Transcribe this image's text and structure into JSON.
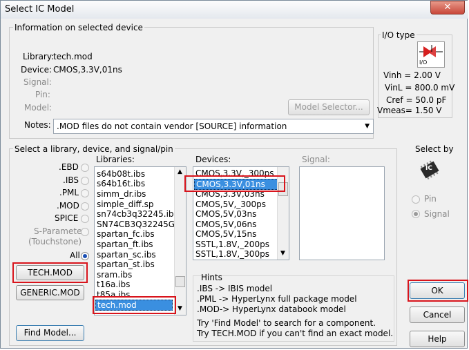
{
  "window": {
    "title": "Select IC Model",
    "close_glyph": "✕"
  },
  "info": {
    "group_label": "Information on selected device",
    "library_label": "Library:",
    "library_value": "tech.mod",
    "device_label": "Device:",
    "device_value": "CMOS,3.3V,01ns",
    "signal_label": "Signal:",
    "pin_label": "Pin:",
    "model_label": "Model:",
    "model_selector_button": "Model Selector...",
    "notes_label": "Notes:",
    "notes_value": ".MOD files do not contain vendor [SOURCE] information"
  },
  "io_type": {
    "group_label": "I/O type",
    "icon_caption": "I/O",
    "vinh": "Vinh = 2.00 V",
    "vinl": "VinL = 800.0 mV",
    "cref": "Cref = 50.0 pF",
    "vmeas": "Vmeas= 1.50 V"
  },
  "select": {
    "group_label": "Select a library, device, and signal/pin",
    "filters": [
      ".EBD",
      ".IBS",
      ".PML",
      ".MOD",
      "SPICE"
    ],
    "sparam_line1": "S-Parameter",
    "sparam_line2": "(Touchstone)",
    "all_label": "All",
    "tech_mod_button": "TECH.MOD",
    "generic_mod_button": "GENERIC.MOD",
    "libraries_label": "Libraries:",
    "libraries": [
      "s64b08t.ibs",
      "s64b16t.ibs",
      "simm_dr.ibs",
      "simple_diff.sp",
      "sn74cb3q32245.ibs",
      "SN74CB3Q32245GK",
      "spartan_fc.ibs",
      "spartan_ft.ibs",
      "spartan_sc.ibs",
      "spartan_st.ibs",
      "sram.ibs",
      "t16a.ibs",
      "t85a.ibs"
    ],
    "selected_library": "tech.mod",
    "devices_label": "Devices:",
    "devices": [
      "CMOS,3.3V,_300ps",
      "CMOS,3.3V,01ns",
      "CMOS,3.3V,03ns",
      "CMOS,5V,_300ps",
      "CMOS,5V,03ns",
      "CMOS,5V,06ns",
      "CMOS,5V,15ns",
      "SSTL,1.8V,_200ps",
      "SSTL,1.8V,_300ps"
    ],
    "signal_label": "Signal:",
    "hints": {
      "title": "Hints",
      "lines": [
        ".IBS   -> IBIS model",
        ".PML -> HyperLynx full package model",
        ".MOD-> HyperLynx databook model",
        "",
        "Try 'Find Model' to search for a component.",
        "Try TECH.MOD if you can't find an exact model."
      ]
    }
  },
  "select_by": {
    "label": "Select by",
    "pin": "Pin",
    "signal": "Signal",
    "chip_text": "IC"
  },
  "buttons": {
    "ok": "OK",
    "cancel": "Cancel",
    "help": "Help",
    "find_model": "Find Model..."
  }
}
